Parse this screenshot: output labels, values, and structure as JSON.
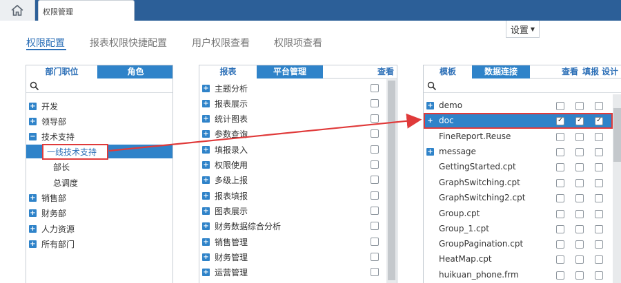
{
  "window": {
    "tab_title": "权限管理"
  },
  "nav": {
    "tabs": [
      "权限配置",
      "报表权限快捷配置",
      "用户权限查看",
      "权限项查看"
    ]
  },
  "settings": {
    "label": "设置"
  },
  "panel1": {
    "tabs": [
      "部门职位",
      "角色"
    ],
    "tree": [
      {
        "label": "开发"
      },
      {
        "label": "领导部"
      },
      {
        "label": "技术支持"
      },
      {
        "label": "一线技术支持"
      },
      {
        "label": "部长"
      },
      {
        "label": "总调度"
      },
      {
        "label": "销售部"
      },
      {
        "label": "财务部"
      },
      {
        "label": "人力资源"
      },
      {
        "label": "所有部门"
      }
    ]
  },
  "panel2": {
    "tabs": [
      "报表",
      "平台管理"
    ],
    "header_right": "查看",
    "items": [
      "主题分析",
      "报表展示",
      "统计图表",
      "参数查询",
      "填报录入",
      "权限使用",
      "多级上报",
      "报表填报",
      "图表展示",
      "财务数据综合分析",
      "销售管理",
      "财务管理",
      "运营管理"
    ]
  },
  "panel3": {
    "tabs": [
      "模板",
      "数据连接"
    ],
    "header_cols": [
      "查看",
      "填报",
      "设计"
    ],
    "items": [
      "demo",
      "doc",
      "FineReport.Reuse",
      "message",
      "GettingStarted.cpt",
      "GraphSwitching.cpt",
      "GraphSwitching2.cpt",
      "Group.cpt",
      "Group_1.cpt",
      "GroupPagination.cpt",
      "HeatMap.cpt",
      "huikuan_phone.frm"
    ]
  },
  "colors": {
    "accent": "#2f83c9",
    "topbar": "#2c5f98",
    "highlight_box": "#e03a3a"
  }
}
